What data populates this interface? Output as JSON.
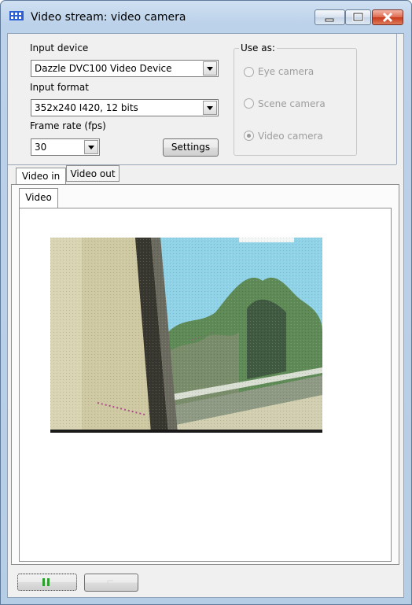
{
  "window": {
    "title": "Video stream: video camera",
    "icon": "camera-grid-icon",
    "controls": [
      "minimize-icon",
      "maximize-icon",
      "close-icon"
    ]
  },
  "input_device": {
    "label": "Input device",
    "value": "Dazzle DVC100 Video Device"
  },
  "input_format": {
    "label": "Input format",
    "value": "352x240 I420, 12 bits"
  },
  "frame_rate": {
    "label": "Frame rate (fps)",
    "value": "30"
  },
  "settings_button": "Settings",
  "use_as": {
    "title": "Use as:",
    "options": [
      {
        "label": "Eye camera",
        "selected": false
      },
      {
        "label": "Scene camera",
        "selected": false
      },
      {
        "label": "Video camera",
        "selected": true
      }
    ]
  },
  "tabs": {
    "items": [
      "Video in",
      "Video out"
    ],
    "active": "Video in",
    "subtab": "Video"
  },
  "footer": {
    "play_pause_icon": "pause-icon",
    "stop_icon": "stop-icon"
  },
  "colors": {
    "pause_green": "#2e9e2e",
    "sky": "#8fd3e8",
    "wall": "#c9c4a0"
  }
}
